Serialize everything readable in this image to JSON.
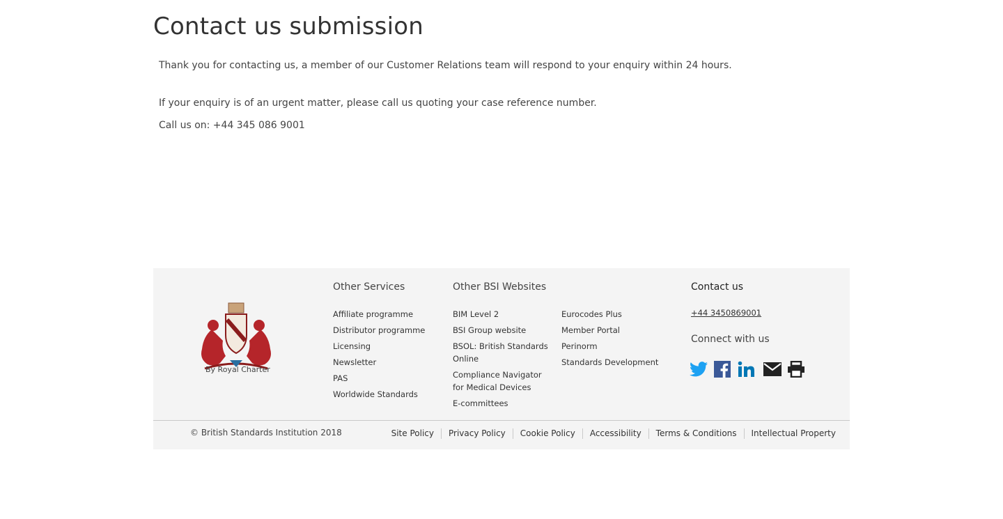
{
  "main": {
    "title": "Contact us submission",
    "thanks": "Thank you for contacting us, a member of our Customer Relations team will respond to your enquiry within 24 hours.",
    "urgent": "If your enquiry is of an urgent matter, please call us quoting your case reference number.",
    "call": "Call us on: +44 345 086 9001"
  },
  "footer": {
    "crest_caption": "By Royal Charter",
    "other_services": {
      "title": "Other Services",
      "links": [
        "Affiliate programme",
        "Distributor programme",
        "Licensing",
        "Newsletter",
        "PAS",
        "Worldwide Standards"
      ]
    },
    "other_websites": {
      "title": "Other BSI Websites",
      "col1": [
        "BIM Level 2",
        "BSI Group website",
        "BSOL: British Standards Online",
        "Compliance Navigator for Medical Devices",
        "E-committees"
      ],
      "col2": [
        "Eurocodes Plus",
        "Member Portal",
        "Perinorm",
        "Standards Development"
      ]
    },
    "contact": {
      "title": "Contact us",
      "phone": "+44 3450869001",
      "connect_title": "Connect with us"
    },
    "social": [
      {
        "icon": "twitter-icon",
        "color": "#1da1f2"
      },
      {
        "icon": "facebook-icon",
        "color": "#3b5998"
      },
      {
        "icon": "linkedin-icon",
        "color": "#0077b5"
      },
      {
        "icon": "email-icon",
        "color": "#222222"
      },
      {
        "icon": "print-icon",
        "color": "#222222"
      }
    ],
    "copyright": "© British Standards Institution 2018",
    "legal_links": [
      "Site Policy",
      "Privacy Policy",
      "Cookie Policy",
      "Accessibility",
      "Terms & Conditions",
      "Intellectual Property"
    ]
  }
}
